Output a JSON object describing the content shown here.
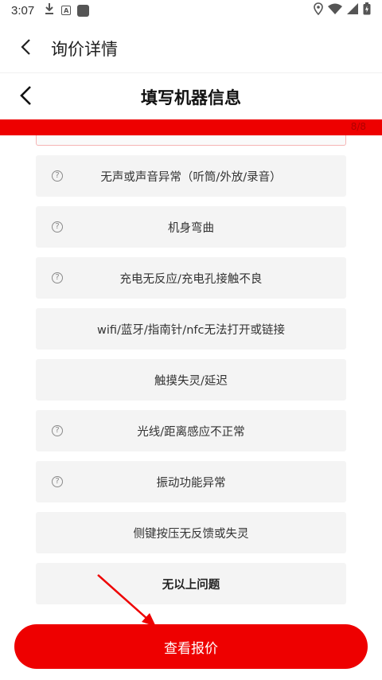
{
  "status_bar": {
    "time": "3:07",
    "left_icons": [
      "download-icon",
      "a-box-icon",
      "square-icon"
    ],
    "right_icons": [
      "location-icon",
      "wifi-icon",
      "signal-icon",
      "battery-icon"
    ]
  },
  "app_header": {
    "title": "询价详情"
  },
  "form_header": {
    "title": "填写机器信息"
  },
  "progress": {
    "text": "8/8",
    "fraction": 1.0,
    "color": "#ee0000"
  },
  "options": [
    {
      "label": "无声或声音异常（听筒/外放/录音）",
      "has_help": true
    },
    {
      "label": "机身弯曲",
      "has_help": true
    },
    {
      "label": "充电无反应/充电孔接触不良",
      "has_help": true
    },
    {
      "label": "wifi/蓝牙/指南针/nfc无法打开或链接",
      "has_help": false
    },
    {
      "label": "触摸失灵/延迟",
      "has_help": false
    },
    {
      "label": "光线/距离感应不正常",
      "has_help": true
    },
    {
      "label": "振动功能异常",
      "has_help": true
    },
    {
      "label": "侧键按压无反馈或失灵",
      "has_help": false
    },
    {
      "label": "无以上问题",
      "has_help": false,
      "bold": true
    }
  ],
  "help_symbol": "?",
  "submit_label": "查看报价",
  "colors": {
    "accent": "#ee0000",
    "option_bg": "#f4f4f4"
  }
}
